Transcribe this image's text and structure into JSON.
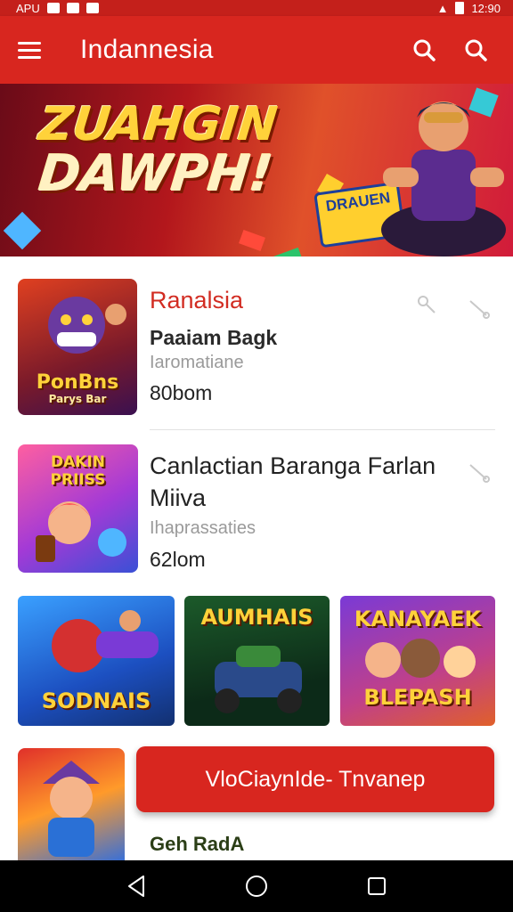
{
  "status_bar": {
    "left_text": "APU",
    "time": "12:90"
  },
  "app_bar": {
    "title": "Indannesia"
  },
  "banner": {
    "line1": "ZUAHGIN",
    "line2": "DAWPH!",
    "badge_text": "DRAUEN"
  },
  "items": [
    {
      "title": "Ranalsia",
      "subtitle": "Paaiam Bagk",
      "category": "Iaromatiane",
      "size": "80bom",
      "thumb_text_top": "PonBns",
      "thumb_text_bottom": "Parys Bar"
    },
    {
      "title_line1": "Canlactian Baranga Farlan",
      "title_line2": "Miiva",
      "category": "Ihaprassaties",
      "size": "62lom",
      "thumb_text": "DAKIN PRIISS"
    }
  ],
  "grid_tiles": [
    {
      "label": "SODNAIS"
    },
    {
      "label": "AUMHAIS"
    },
    {
      "label_top": "KANAYAEK",
      "label_bottom": "BLEPASH"
    }
  ],
  "cta": {
    "label": "VloCiaynIde- Tnvanep"
  },
  "bottom_item": {
    "label": "Geh RadA"
  },
  "colors": {
    "primary": "#d8261f",
    "status_bar": "#c4201b",
    "accent_title": "#d22c22"
  },
  "icons": [
    "menu-icon",
    "search-icon",
    "search-icon",
    "key-icon",
    "link-icon",
    "back-icon",
    "home-icon",
    "recents-icon"
  ]
}
